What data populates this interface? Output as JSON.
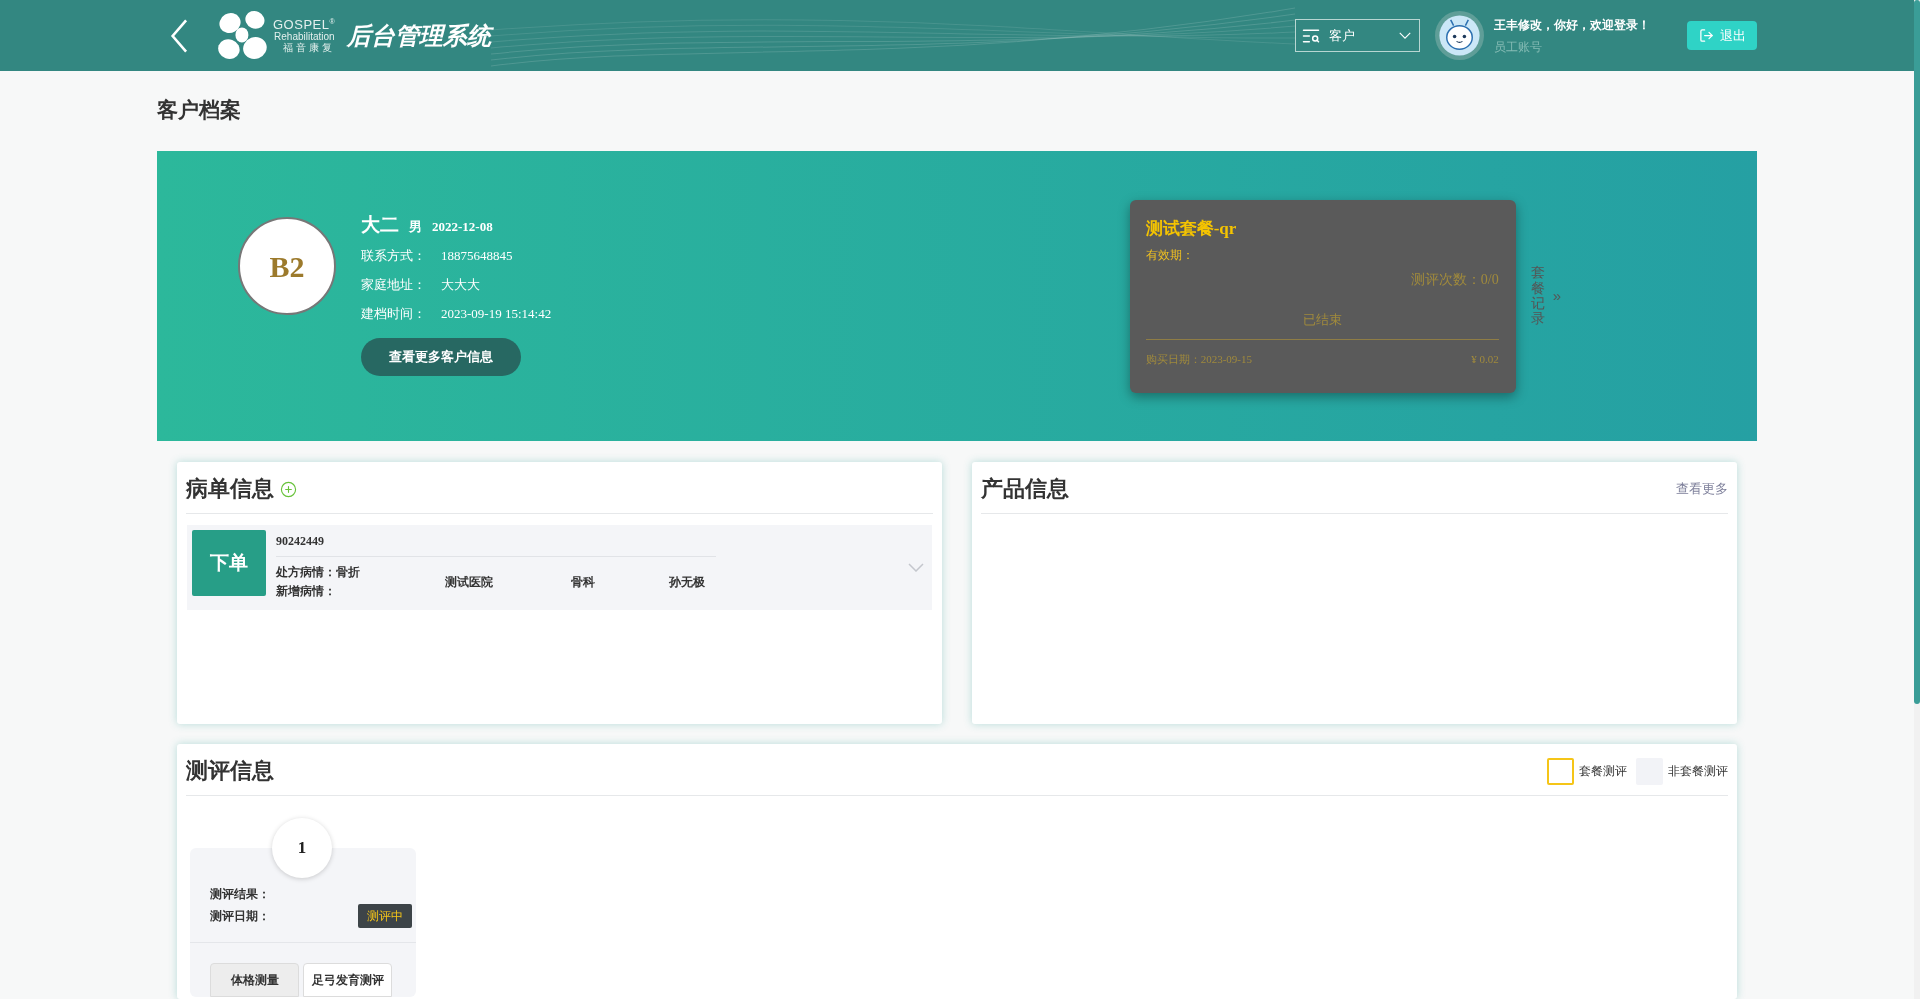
{
  "header": {
    "logo": {
      "brand": "GOSPEL",
      "mark": "®",
      "subtitle": "Rehabilitation",
      "chinese_name": "福音康复"
    },
    "system_title": "后台管理系统",
    "search_select": {
      "value": "客户"
    },
    "user": {
      "greeting": "王丰修改，你好，欢迎登录！",
      "role": "员工账号"
    },
    "logout_button": "退出"
  },
  "page_title": "客户档案",
  "customer": {
    "avatar_text": "B2",
    "name": "大二",
    "gender": "男",
    "birth_date": "2022-12-08",
    "details": [
      {
        "label": "联系方式：",
        "value": "18875648845"
      },
      {
        "label": "家庭地址：",
        "value": "大大大"
      },
      {
        "label": "建档时间：",
        "value": "2023-09-19 15:14:42"
      }
    ],
    "more_button": "查看更多客户信息"
  },
  "package_card": {
    "name": "测试套餐-qr",
    "validity_label": "有效期：",
    "usage": "测评次数：0/0",
    "status": "已结束",
    "purchase_date": "购买日期：2023-09-15",
    "price": "¥ 0.02"
  },
  "package_records_link": {
    "label": "套餐记录",
    "arrow": "»"
  },
  "case_panel": {
    "title": "病单信息",
    "records": [
      {
        "order_button": "下单",
        "number": "90242449",
        "prescription": "处方病情：骨折",
        "new_condition": "新增病情：",
        "hospital": "测试医院",
        "department": "骨科",
        "doctor": "孙无极",
        "expanded": false
      }
    ]
  },
  "product_panel": {
    "title": "产品信息",
    "more_link": "查看更多"
  },
  "evaluation_panel": {
    "title": "测评信息",
    "legend": [
      {
        "kind": "package",
        "label": "套餐测评"
      },
      {
        "kind": "non_package",
        "label": "非套餐测评"
      }
    ],
    "items": [
      {
        "kind": "non_package",
        "number": "1",
        "result_label": "测评结果：",
        "date_label": "测评日期：",
        "status": "测评中",
        "tests": [
          {
            "label": "体格测量",
            "selected": true
          },
          {
            "label": "足弓发育测评",
            "selected": false
          }
        ]
      }
    ]
  }
}
